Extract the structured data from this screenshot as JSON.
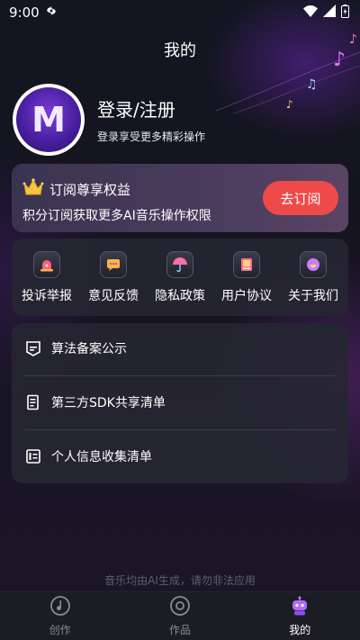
{
  "status_bar": {
    "time": "9:00"
  },
  "header": {
    "title": "我的"
  },
  "profile": {
    "login_title": "登录/注册",
    "login_subtitle": "登录享受更多精彩操作",
    "avatar_letter": "M"
  },
  "subscription": {
    "title": "订阅尊享权益",
    "description": "积分订阅获取更多AI音乐操作权限",
    "button_label": "去订阅",
    "button_color": "#ef4a4a"
  },
  "quick_actions": [
    {
      "label": "投诉举报",
      "icon": "alarm-icon"
    },
    {
      "label": "意见反馈",
      "icon": "message-icon"
    },
    {
      "label": "隐私政策",
      "icon": "umbrella-icon"
    },
    {
      "label": "用户协议",
      "icon": "book-icon"
    },
    {
      "label": "关于我们",
      "icon": "smile-icon"
    }
  ],
  "list_items": [
    {
      "label": "算法备案公示",
      "icon": "shield-doc-icon"
    },
    {
      "label": "第三方SDK共享清单",
      "icon": "document-list-icon"
    },
    {
      "label": "个人信息收集清单",
      "icon": "id-card-icon"
    }
  ],
  "footer_note": "音乐均由AI生成，请勿非法应用",
  "bottom_nav": [
    {
      "label": "创作",
      "icon": "music-note-icon",
      "active": false
    },
    {
      "label": "作品",
      "icon": "disc-icon",
      "active": false
    },
    {
      "label": "我的",
      "icon": "robot-icon",
      "active": true
    }
  ]
}
